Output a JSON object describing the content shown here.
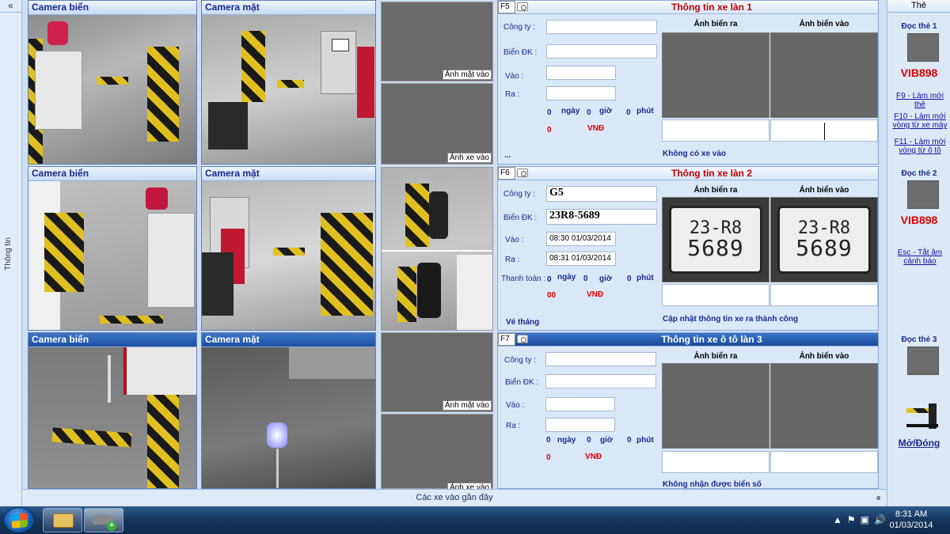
{
  "left_panel": {
    "collapse_symbol": "«",
    "vertical_label": "Thông tin"
  },
  "cameras": [
    {
      "title": "Camera biển"
    },
    {
      "title": "Camera mặt"
    },
    {
      "title": "Camera biển"
    },
    {
      "title": "Camera mặt"
    },
    {
      "title": "Camera biển"
    },
    {
      "title": "Camera mặt"
    }
  ],
  "thumbnails": [
    {
      "caption": "Ảnh mặt vào"
    },
    {
      "caption": "Ảnh xe vào"
    },
    {
      "caption": ""
    },
    {
      "caption": "Ảnh mặt vào"
    },
    {
      "caption": "Ảnh xe vào"
    }
  ],
  "lanes": [
    {
      "key": "F5",
      "title": "Thông tin xe làn 1",
      "labels": {
        "company": "Công ty :",
        "plate": "Biển ĐK :",
        "in": "Vào :",
        "out": "Ra :",
        "payment": ""
      },
      "values": {
        "company": "",
        "plate": "",
        "in": "",
        "out": ""
      },
      "duration": {
        "days": "0",
        "days_label": "ngày",
        "hours": "0",
        "hours_label": "giờ",
        "minutes": "0",
        "minutes_label": "phút"
      },
      "fee": {
        "amount": "0",
        "currency": "VNĐ"
      },
      "ellipsis": "...",
      "ticket_type": "",
      "image_heads": {
        "out": "Ảnh biển ra",
        "in": "Ảnh biển vào"
      },
      "status": "Không có xe vào"
    },
    {
      "key": "F6",
      "title": "Thông tin xe làn 2",
      "labels": {
        "company": "Công ty :",
        "plate": "Biển ĐK :",
        "in": "Vào :",
        "out": "Ra :",
        "payment": "Thanh toán :"
      },
      "values": {
        "company": "G5",
        "plate": "23R8-5689",
        "in": "08:30 01/03/2014",
        "out": "08:31 01/03/2014"
      },
      "duration": {
        "days": "0",
        "days_label": "ngày",
        "hours": "0",
        "hours_label": "giờ",
        "minutes": "0",
        "minutes_label": "phút"
      },
      "fee": {
        "amount": "00",
        "currency": "VNĐ"
      },
      "ellipsis": "",
      "ticket_type": "Vé tháng",
      "image_heads": {
        "out": "Ảnh biển ra",
        "in": "Ảnh biển vào"
      },
      "plate_line1": "23-R8",
      "plate_line2": "5689",
      "status": "Cập nhật thông tin xe ra thành công"
    },
    {
      "key": "F7",
      "title": "Thông tin xe ô tô làn 3",
      "labels": {
        "company": "Công ty :",
        "plate": "Biển ĐK :",
        "in": "Vào :",
        "out": "Ra :",
        "payment": ""
      },
      "values": {
        "company": "",
        "plate": "",
        "in": "",
        "out": ""
      },
      "duration": {
        "days": "0",
        "days_label": "ngày",
        "hours": "0",
        "hours_label": "giờ",
        "minutes": "0",
        "minutes_label": "phút"
      },
      "fee": {
        "amount": "0",
        "currency": "VNĐ"
      },
      "ellipsis": "",
      "ticket_type": "",
      "image_heads": {
        "out": "Ảnh biển ra",
        "in": "Ảnh biển vào"
      },
      "status": "Không nhận được biển số"
    }
  ],
  "right_panel": {
    "header": "Thẻ",
    "reader1": {
      "title": "Đọc thẻ 1",
      "card_id": "VIB898"
    },
    "links1": [
      "F9 - Làm mới thẻ",
      "F10 - Làm mới vòng từ xe máy",
      "F11 - Làm mới vòng từ ô tô"
    ],
    "reader2": {
      "title": "Đọc thẻ 2",
      "card_id": "VIB898"
    },
    "links2": [
      "Esc - Tắt âm cảnh báo"
    ],
    "reader3": {
      "title": "Đọc thẻ 3"
    },
    "barrier_label": "Mở/Đóng"
  },
  "recent_bar": {
    "label": "Các xe vào gần đây",
    "chevron": "«"
  },
  "taskbar": {
    "time": "8:31 AM",
    "date": "01/03/2014",
    "tray_icons": [
      "▲",
      "⚑",
      "▣",
      "🔊"
    ]
  }
}
